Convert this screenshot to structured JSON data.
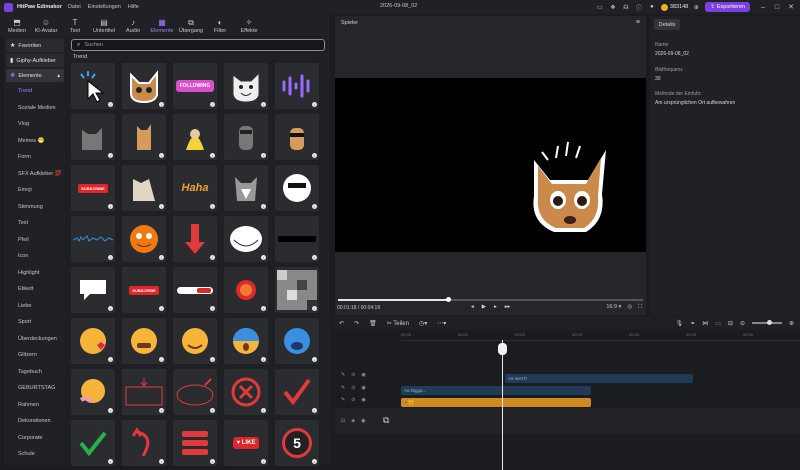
{
  "app": {
    "name": "HitPaw Edimakor",
    "menu": [
      "Datei",
      "Einstellungen",
      "Hilfe"
    ],
    "project_title": "2026-09-08_02",
    "coins": "383148",
    "export_label": "Exportieren"
  },
  "toptabs": [
    {
      "label": "Medien",
      "icon": "media-icon"
    },
    {
      "label": "KI-Avatar",
      "icon": "avatar-icon"
    },
    {
      "label": "Text",
      "icon": "text-icon"
    },
    {
      "label": "Untertitel",
      "icon": "subtitle-icon"
    },
    {
      "label": "Audio",
      "icon": "music-icon"
    },
    {
      "label": "Elemente",
      "icon": "elements-icon",
      "active": true
    },
    {
      "label": "Übergang",
      "icon": "transition-icon"
    },
    {
      "label": "Filter",
      "icon": "filter-icon"
    },
    {
      "label": "Effekte",
      "icon": "effects-icon"
    }
  ],
  "leftnav": {
    "favorites": "Favoriten",
    "giphy": "Giphy-Aufkleber",
    "elements": "Elemente",
    "sub": [
      "Trend",
      "Soziale Medien",
      "Vlog",
      "Memes 😁",
      "Form",
      "SFX Aufkleber 💯",
      "Emoji",
      "Stimmung",
      "Text",
      "Pfeil",
      "Icon",
      "Highlight",
      "Etikett",
      "Liebe",
      "Sport",
      "Überdeckungen",
      "Glitzern",
      "Tagebuch",
      "GEBURTSTAG",
      "Rahmen",
      "Dekorationen",
      "Corporate",
      "Schule"
    ]
  },
  "panel": {
    "search_placeholder": "Suchen",
    "section": "Trend",
    "tiles": [
      "tap-cursor-sticker",
      "cat-face-sticker",
      "following-sticker",
      "cat-smile-sticker",
      "sound-wave-sticker",
      "cat-sitting-sticker",
      "cat-dancing-sticker",
      "cat-banana-sticker",
      "raccoon-sticker",
      "cat-sunglasses-sticker",
      "subscribe-sticker",
      "cat-pose-sticker",
      "haha-sticker",
      "husky-sticker",
      "cat-shades-sticker",
      "equalizer-sticker",
      "orange-face-sticker",
      "down-arrow-sticker",
      "troll-face-sticker",
      "black-bar-sticker",
      "speech-bubble-sticker",
      "subscribe-click-sticker",
      "subscribe-bar-sticker",
      "like-burst-sticker",
      "pixel-glitch-sticker",
      "love-emoji-sticker",
      "sad-emoji-sticker",
      "wink-emoji-sticker",
      "scared-emoji-sticker",
      "crying-emoji-sticker",
      "thinking-emoji-sticker",
      "red-frame-arrow-sticker",
      "red-circle-arrow-sticker",
      "red-x-sticker",
      "red-check-sticker",
      "green-check-sticker",
      "red-curved-arrow-sticker",
      "subscribe-list-sticker",
      "like-button-sticker",
      "number-five-sticker"
    ],
    "like_text": "LIKE",
    "five_text": "5",
    "follow_text": "FOLLOWING",
    "subscribe_text": "SUBSCRIBE",
    "haha_text": "Haha"
  },
  "player": {
    "title": "Spieler",
    "time_current": "00:01:18",
    "time_total": "00:04:18",
    "ratio": "16:9",
    "progress": 0.36
  },
  "details": {
    "tab": "Details",
    "name_label": "Name",
    "name_value": "2026-09-08_02",
    "fps_label": "Bildfrequenz",
    "fps_value": "30",
    "method_label": "Methode der Einfuhr:",
    "method_value": "Am ursprünglichen Ort aufbewahren"
  },
  "timeline": {
    "split_label": "Teilen",
    "ticks": [
      "00:00",
      "00:01",
      "00:02",
      "00:03",
      "00:04",
      "00:05",
      "00:06"
    ],
    "clip1": "Aa WAIT!",
    "clip2": "Aa Digga..."
  },
  "colors": {
    "accent": "#7b3fe4",
    "accent_text": "#a77cff"
  }
}
